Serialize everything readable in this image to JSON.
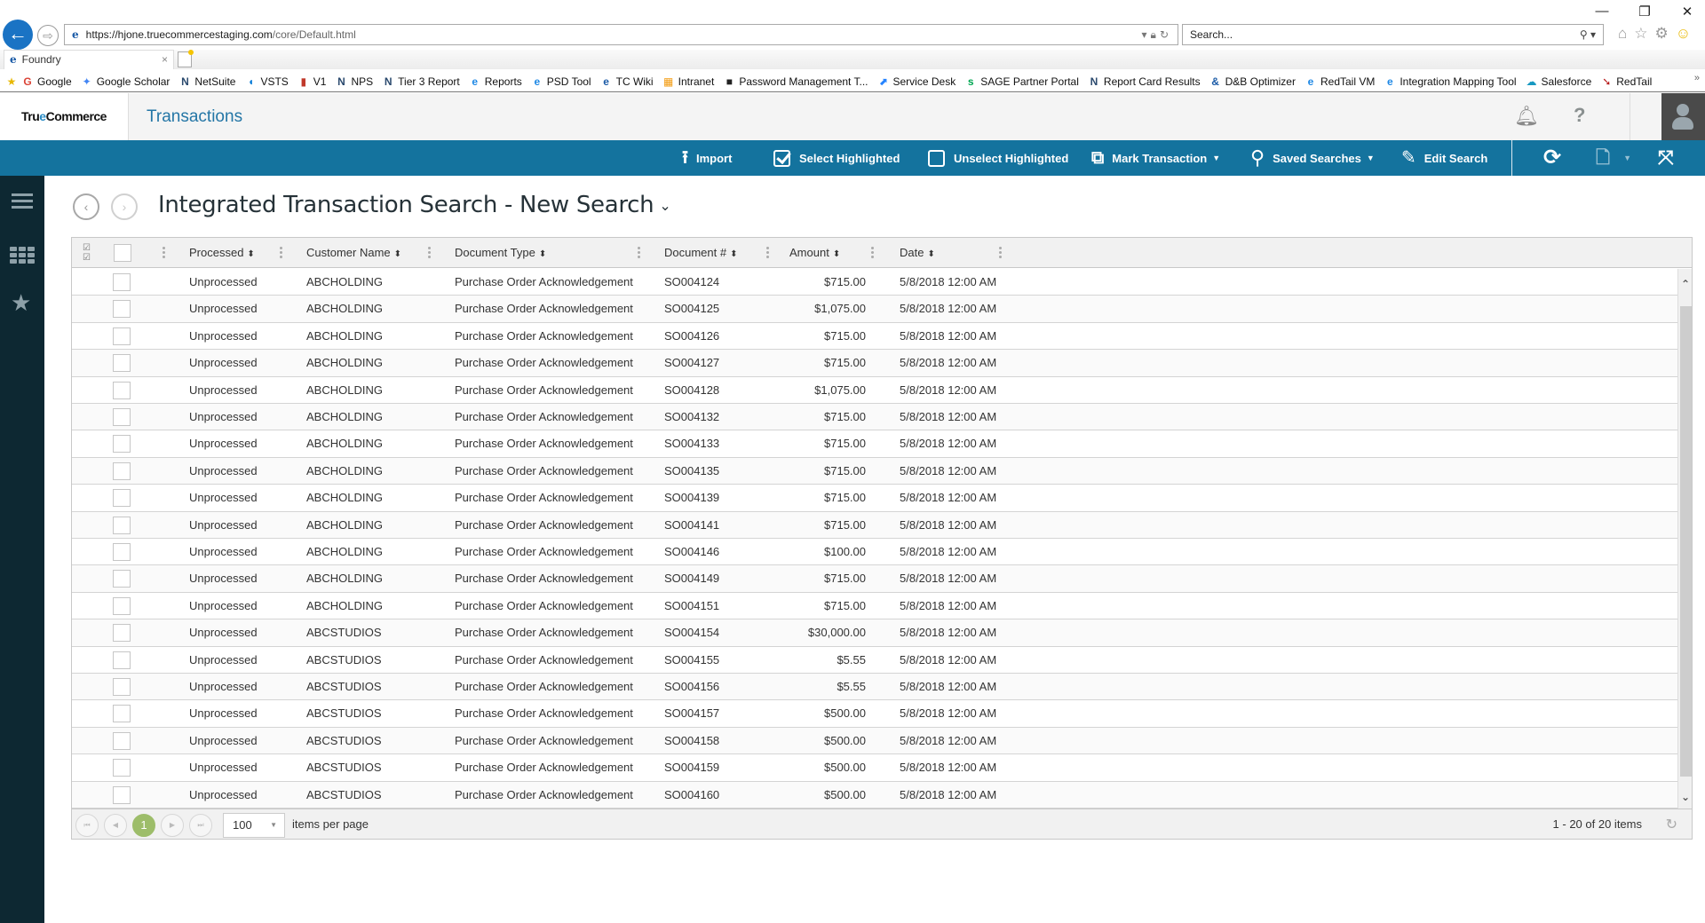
{
  "browser": {
    "window_controls": {
      "minimize": "—",
      "restore": "❐",
      "close": "✕"
    },
    "url_host": "https://hjone.truecommercestaging.com",
    "url_path": "/core/Default.html",
    "search_placeholder": "Search...",
    "tab_title": "Foundry",
    "bookmarks": [
      {
        "label": "Google",
        "icon": "google-icon",
        "glyph": "G",
        "color": "#db4437"
      },
      {
        "label": "Google Scholar",
        "icon": "google-scholar-icon",
        "glyph": "✦",
        "color": "#4285f4"
      },
      {
        "label": "NetSuite",
        "icon": "netsuite-icon",
        "glyph": "N",
        "color": "#2b4a6e"
      },
      {
        "label": "VSTS",
        "icon": "vsts-icon",
        "glyph": "◖",
        "color": "#0078d7"
      },
      {
        "label": "V1",
        "icon": "v1-icon",
        "glyph": "▮",
        "color": "#c0392b"
      },
      {
        "label": "NPS",
        "icon": "nps-icon",
        "glyph": "N",
        "color": "#2b4a6e"
      },
      {
        "label": "Tier 3 Report",
        "icon": "tier3-report-icon",
        "glyph": "N",
        "color": "#2b4a6e"
      },
      {
        "label": "Reports",
        "icon": "ie-page-icon",
        "glyph": "e",
        "color": "#1e88e5"
      },
      {
        "label": "PSD Tool",
        "icon": "ie-page-icon",
        "glyph": "e",
        "color": "#1e88e5"
      },
      {
        "label": "TC Wiki",
        "icon": "ie-icon",
        "glyph": "e",
        "color": "#1a5aa6"
      },
      {
        "label": "Intranet",
        "icon": "intranet-icon",
        "glyph": "▦",
        "color": "#f39c12"
      },
      {
        "label": "Password Management T...",
        "icon": "pwm-icon",
        "glyph": "■",
        "color": "#222222"
      },
      {
        "label": "Service Desk",
        "icon": "service-desk-icon",
        "glyph": "⬈",
        "color": "#2684ff"
      },
      {
        "label": "SAGE Partner Portal",
        "icon": "sage-icon",
        "glyph": "s",
        "color": "#00a651"
      },
      {
        "label": "Report Card Results",
        "icon": "report-card-icon",
        "glyph": "N",
        "color": "#2b4a6e"
      },
      {
        "label": "D&B Optimizer",
        "icon": "dnb-icon",
        "glyph": "&",
        "color": "#1a5aa6"
      },
      {
        "label": "RedTail VM",
        "icon": "ie-page-icon",
        "glyph": "e",
        "color": "#1e88e5"
      },
      {
        "label": "Integration Mapping Tool",
        "icon": "ie-page-icon",
        "glyph": "e",
        "color": "#1e88e5"
      },
      {
        "label": "Salesforce",
        "icon": "salesforce-icon",
        "glyph": "☁",
        "color": "#1798c1"
      },
      {
        "label": "RedTail",
        "icon": "redtail-icon",
        "glyph": "➘",
        "color": "#b71c1c"
      }
    ],
    "more_bookmarks": "»"
  },
  "app": {
    "logo_part1": "Tru",
    "logo_part2": "e",
    "logo_part3": "Commerce",
    "section_title": "Transactions"
  },
  "toolbar": {
    "import": "Import",
    "select_highlighted": "Select Highlighted",
    "unselect_highlighted": "Unselect Highlighted",
    "mark_transaction": "Mark Transaction",
    "saved_searches": "Saved Searches",
    "edit_search": "Edit Search"
  },
  "page": {
    "title": "Integrated Transaction Search - New Search"
  },
  "grid": {
    "columns": [
      {
        "key": "processed",
        "label": "Processed"
      },
      {
        "key": "customer",
        "label": "Customer Name"
      },
      {
        "key": "doctype",
        "label": "Document Type"
      },
      {
        "key": "docnum",
        "label": "Document #"
      },
      {
        "key": "amount",
        "label": "Amount"
      },
      {
        "key": "date",
        "label": "Date"
      }
    ],
    "rows": [
      {
        "processed": "Unprocessed",
        "customer": "ABCHOLDING",
        "doctype": "Purchase Order Acknowledgement",
        "docnum": "SO004124",
        "amount": "$715.00",
        "date": "5/8/2018 12:00 AM"
      },
      {
        "processed": "Unprocessed",
        "customer": "ABCHOLDING",
        "doctype": "Purchase Order Acknowledgement",
        "docnum": "SO004125",
        "amount": "$1,075.00",
        "date": "5/8/2018 12:00 AM"
      },
      {
        "processed": "Unprocessed",
        "customer": "ABCHOLDING",
        "doctype": "Purchase Order Acknowledgement",
        "docnum": "SO004126",
        "amount": "$715.00",
        "date": "5/8/2018 12:00 AM"
      },
      {
        "processed": "Unprocessed",
        "customer": "ABCHOLDING",
        "doctype": "Purchase Order Acknowledgement",
        "docnum": "SO004127",
        "amount": "$715.00",
        "date": "5/8/2018 12:00 AM"
      },
      {
        "processed": "Unprocessed",
        "customer": "ABCHOLDING",
        "doctype": "Purchase Order Acknowledgement",
        "docnum": "SO004128",
        "amount": "$1,075.00",
        "date": "5/8/2018 12:00 AM"
      },
      {
        "processed": "Unprocessed",
        "customer": "ABCHOLDING",
        "doctype": "Purchase Order Acknowledgement",
        "docnum": "SO004132",
        "amount": "$715.00",
        "date": "5/8/2018 12:00 AM"
      },
      {
        "processed": "Unprocessed",
        "customer": "ABCHOLDING",
        "doctype": "Purchase Order Acknowledgement",
        "docnum": "SO004133",
        "amount": "$715.00",
        "date": "5/8/2018 12:00 AM"
      },
      {
        "processed": "Unprocessed",
        "customer": "ABCHOLDING",
        "doctype": "Purchase Order Acknowledgement",
        "docnum": "SO004135",
        "amount": "$715.00",
        "date": "5/8/2018 12:00 AM"
      },
      {
        "processed": "Unprocessed",
        "customer": "ABCHOLDING",
        "doctype": "Purchase Order Acknowledgement",
        "docnum": "SO004139",
        "amount": "$715.00",
        "date": "5/8/2018 12:00 AM"
      },
      {
        "processed": "Unprocessed",
        "customer": "ABCHOLDING",
        "doctype": "Purchase Order Acknowledgement",
        "docnum": "SO004141",
        "amount": "$715.00",
        "date": "5/8/2018 12:00 AM"
      },
      {
        "processed": "Unprocessed",
        "customer": "ABCHOLDING",
        "doctype": "Purchase Order Acknowledgement",
        "docnum": "SO004146",
        "amount": "$100.00",
        "date": "5/8/2018 12:00 AM"
      },
      {
        "processed": "Unprocessed",
        "customer": "ABCHOLDING",
        "doctype": "Purchase Order Acknowledgement",
        "docnum": "SO004149",
        "amount": "$715.00",
        "date": "5/8/2018 12:00 AM"
      },
      {
        "processed": "Unprocessed",
        "customer": "ABCHOLDING",
        "doctype": "Purchase Order Acknowledgement",
        "docnum": "SO004151",
        "amount": "$715.00",
        "date": "5/8/2018 12:00 AM"
      },
      {
        "processed": "Unprocessed",
        "customer": "ABCSTUDIOS",
        "doctype": "Purchase Order Acknowledgement",
        "docnum": "SO004154",
        "amount": "$30,000.00",
        "date": "5/8/2018 12:00 AM"
      },
      {
        "processed": "Unprocessed",
        "customer": "ABCSTUDIOS",
        "doctype": "Purchase Order Acknowledgement",
        "docnum": "SO004155",
        "amount": "$5.55",
        "date": "5/8/2018 12:00 AM"
      },
      {
        "processed": "Unprocessed",
        "customer": "ABCSTUDIOS",
        "doctype": "Purchase Order Acknowledgement",
        "docnum": "SO004156",
        "amount": "$5.55",
        "date": "5/8/2018 12:00 AM"
      },
      {
        "processed": "Unprocessed",
        "customer": "ABCSTUDIOS",
        "doctype": "Purchase Order Acknowledgement",
        "docnum": "SO004157",
        "amount": "$500.00",
        "date": "5/8/2018 12:00 AM"
      },
      {
        "processed": "Unprocessed",
        "customer": "ABCSTUDIOS",
        "doctype": "Purchase Order Acknowledgement",
        "docnum": "SO004158",
        "amount": "$500.00",
        "date": "5/8/2018 12:00 AM"
      },
      {
        "processed": "Unprocessed",
        "customer": "ABCSTUDIOS",
        "doctype": "Purchase Order Acknowledgement",
        "docnum": "SO004159",
        "amount": "$500.00",
        "date": "5/8/2018 12:00 AM"
      },
      {
        "processed": "Unprocessed",
        "customer": "ABCSTUDIOS",
        "doctype": "Purchase Order Acknowledgement",
        "docnum": "SO004160",
        "amount": "$500.00",
        "date": "5/8/2018 12:00 AM"
      }
    ]
  },
  "pager": {
    "current_page": "1",
    "page_size": "100",
    "items_per_page_label": "items per page",
    "info": "1 - 20 of 20 items"
  },
  "colors": {
    "toolbar_bg": "#14739e",
    "sidebar_bg": "#0d2832",
    "accent_title": "#2476a6",
    "current_page": "#9dbd6a"
  }
}
